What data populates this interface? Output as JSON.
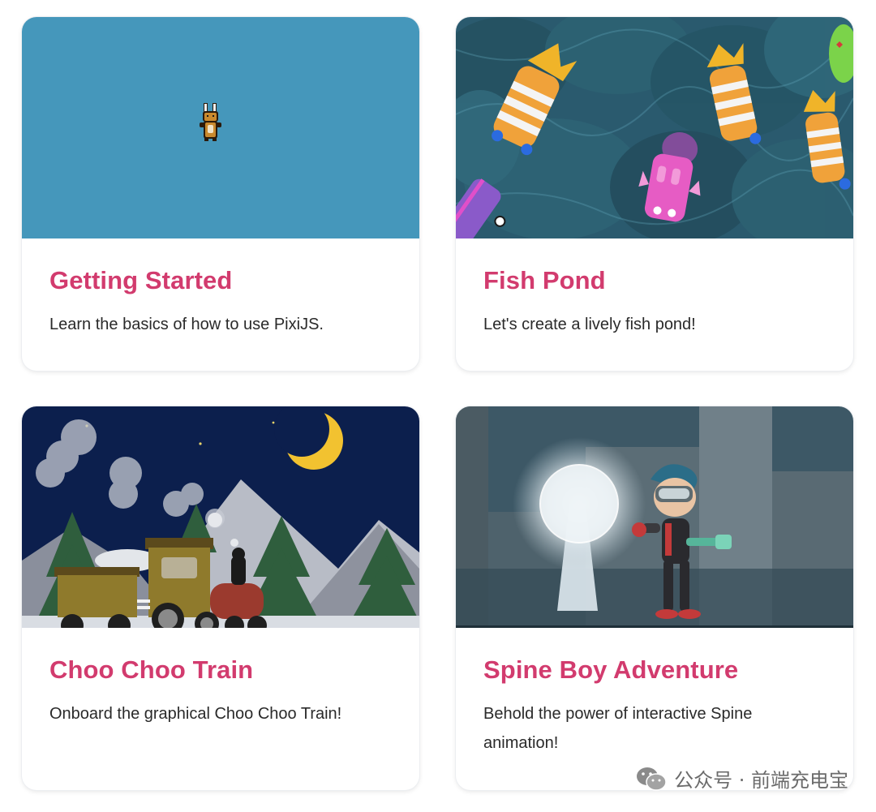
{
  "cards": [
    {
      "title": "Getting Started",
      "description": "Learn the basics of how to use PixiJS.",
      "thumbnail": "bunny-sprite-on-blue",
      "accent": "#d23b6e"
    },
    {
      "title": "Fish Pond",
      "description": "Let's create a lively fish pond!",
      "thumbnail": "fish-pond-scene"
    },
    {
      "title": "Choo Choo Train",
      "description": "Onboard the graphical Choo Choo Train!",
      "thumbnail": "night-train-scene"
    },
    {
      "title": "Spine Boy Adventure",
      "description": "Behold the power of interactive Spine animation!",
      "thumbnail": "spine-boy-scene"
    }
  ],
  "watermark": {
    "text": "公众号 · 前端充电宝",
    "icon": "wechat-icon"
  },
  "colors": {
    "title": "#d23b6e",
    "card_bg": "#ffffff",
    "thumb_blue": "#4597bb"
  }
}
